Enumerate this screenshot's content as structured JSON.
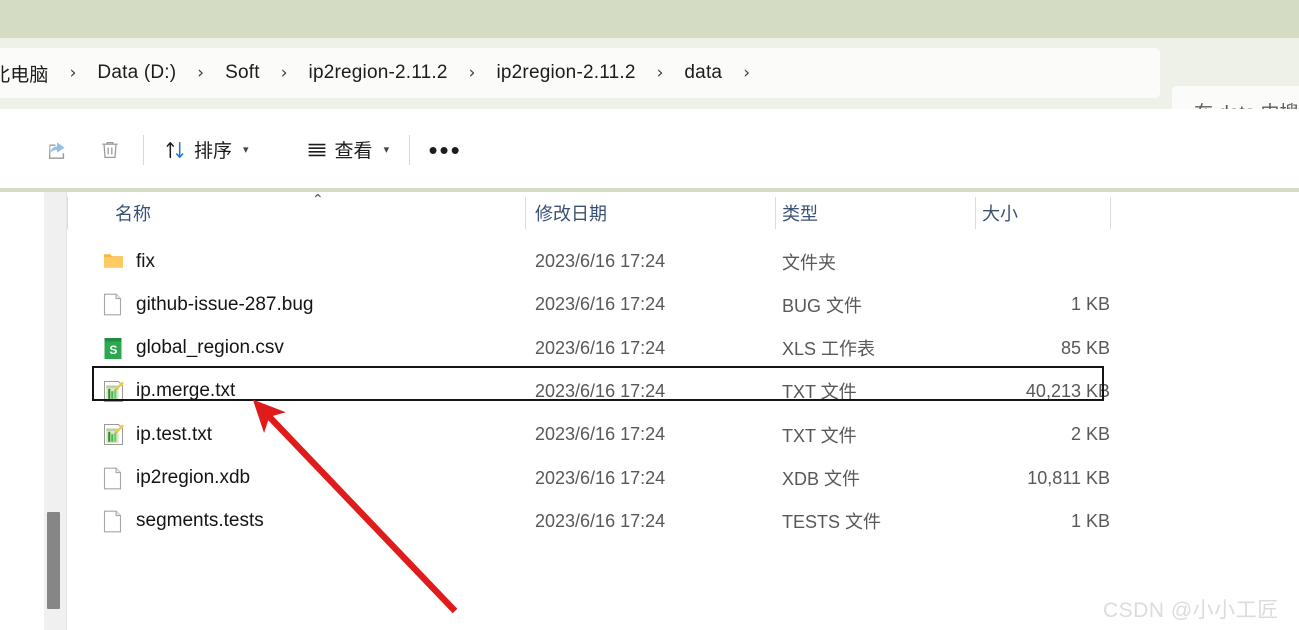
{
  "window": {
    "titlebar_color": "#d4ddc3"
  },
  "address_bar": {
    "breadcrumbs": [
      {
        "label": "北电脑"
      },
      {
        "label": "Data (D:)"
      },
      {
        "label": "Soft"
      },
      {
        "label": "ip2region-2.11.2"
      },
      {
        "label": "ip2region-2.11.2"
      },
      {
        "label": "data"
      }
    ],
    "separator": "›"
  },
  "search": {
    "text": "在 data 中搜"
  },
  "toolbar": {
    "share_label": "share-icon",
    "delete_label": "delete-icon",
    "sort_label": "排序",
    "view_label": "查看",
    "more_label": "•••",
    "chevron": "⌄"
  },
  "columns": {
    "name": "名称",
    "date": "修改日期",
    "type": "类型",
    "size": "大小",
    "sort_caret": "⌃"
  },
  "files": [
    {
      "name": "fix",
      "date": "2023/6/16 17:24",
      "type": "文件夹",
      "size": "",
      "icon": "folder-icon",
      "selected": false
    },
    {
      "name": "github-issue-287.bug",
      "date": "2023/6/16 17:24",
      "type": "BUG 文件",
      "size": "1 KB",
      "icon": "generic-file-icon",
      "selected": false
    },
    {
      "name": "global_region.csv",
      "date": "2023/6/16 17:24",
      "type": "XLS 工作表",
      "size": "85 KB",
      "icon": "csv-file-icon",
      "selected": false
    },
    {
      "name": "ip.merge.txt",
      "date": "2023/6/16 17:24",
      "type": "TXT 文件",
      "size": "40,213 KB",
      "icon": "txt-file-icon",
      "selected": true
    },
    {
      "name": "ip.test.txt",
      "date": "2023/6/16 17:24",
      "type": "TXT 文件",
      "size": "2 KB",
      "icon": "txt-file-icon",
      "selected": false
    },
    {
      "name": "ip2region.xdb",
      "date": "2023/6/16 17:24",
      "type": "XDB 文件",
      "size": "10,811 KB",
      "icon": "generic-file-icon",
      "selected": false
    },
    {
      "name": "segments.tests",
      "date": "2023/6/16 17:24",
      "type": "TESTS 文件",
      "size": "1 KB",
      "icon": "generic-file-icon",
      "selected": false
    }
  ],
  "annotation": {
    "color": "#e01b1b",
    "target_file": "ip.merge.txt"
  },
  "watermark": {
    "text": "CSDN @小小工匠"
  }
}
